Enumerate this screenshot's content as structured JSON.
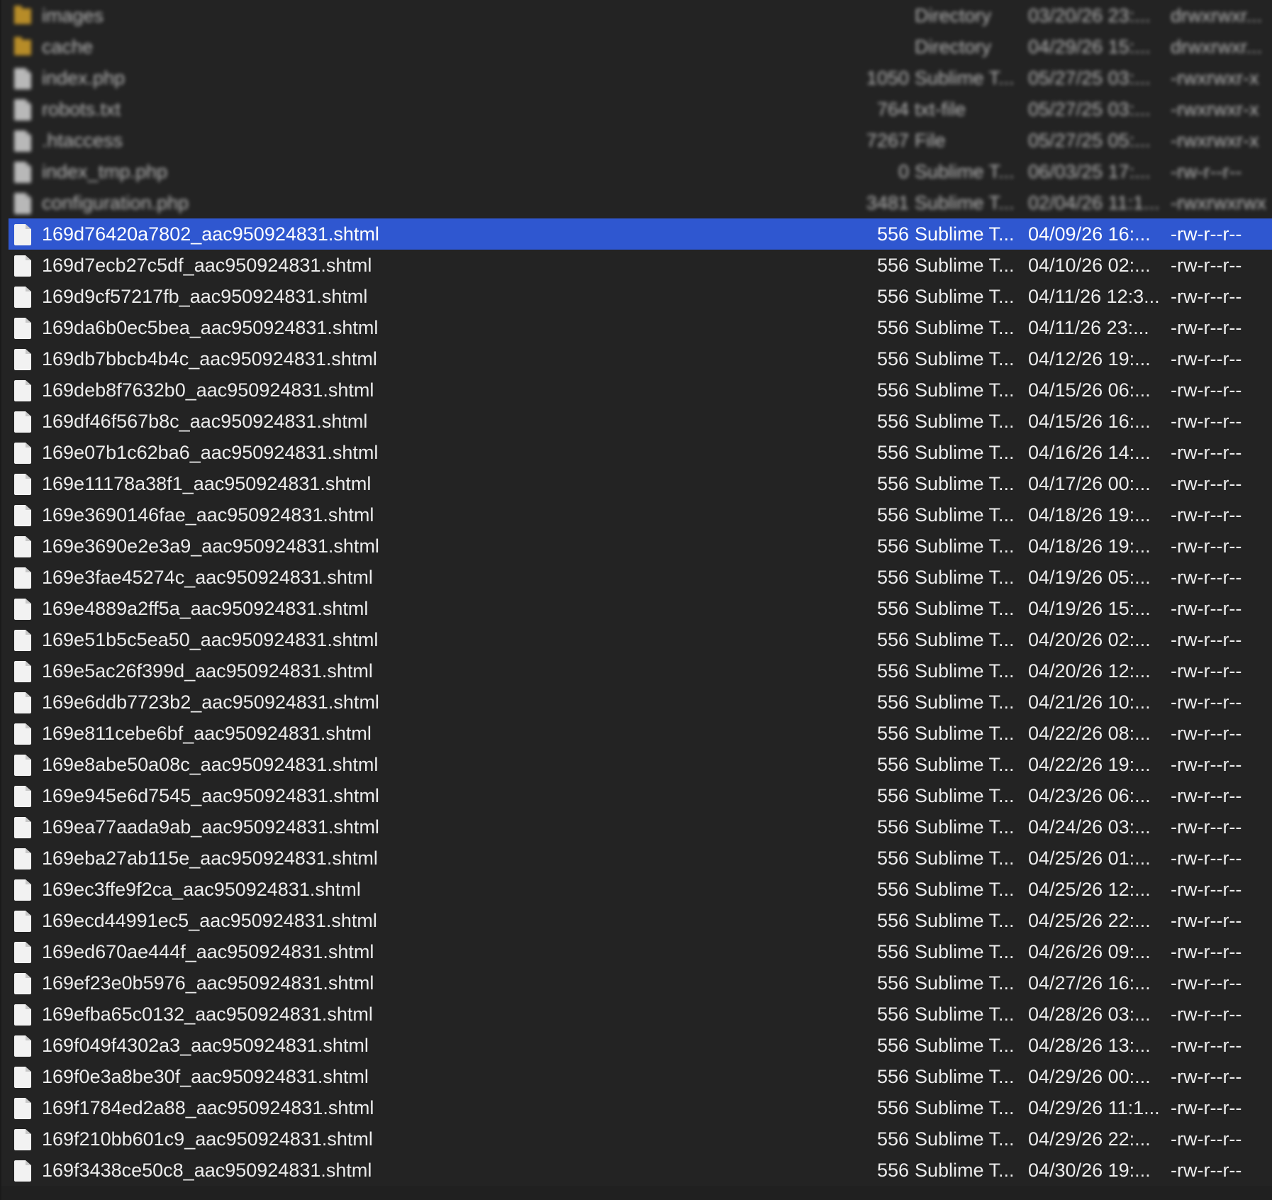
{
  "file_list": {
    "rows": [
      {
        "name": "images",
        "size": "",
        "kind": "Directory",
        "modified": "03/20/26 23:...",
        "perms": "drwxrwxr...",
        "icon": "folder-icon",
        "blurred": true,
        "selected": false
      },
      {
        "name": "cache",
        "size": "",
        "kind": "Directory",
        "modified": "04/29/26 15:...",
        "perms": "drwxrwxr...",
        "icon": "folder-icon",
        "blurred": true,
        "selected": false
      },
      {
        "name": "index.php",
        "size": "1050",
        "kind": "Sublime T...",
        "modified": "05/27/25 03:...",
        "perms": "-rwxrwxr-x",
        "icon": "file-icon",
        "blurred": true,
        "selected": false
      },
      {
        "name": "robots.txt",
        "size": "764",
        "kind": "txt-file",
        "modified": "05/27/25 03:...",
        "perms": "-rwxrwxr-x",
        "icon": "file-icon",
        "blurred": true,
        "selected": false
      },
      {
        "name": ".htaccess",
        "size": "7267",
        "kind": "File",
        "modified": "05/27/25 05:...",
        "perms": "-rwxrwxr-x",
        "icon": "file-icon",
        "blurred": true,
        "selected": false
      },
      {
        "name": "index_tmp.php",
        "size": "0",
        "kind": "Sublime T...",
        "modified": "06/03/25 17:...",
        "perms": "-rw-r--r--",
        "icon": "file-icon",
        "blurred": true,
        "selected": false
      },
      {
        "name": "configuration.php",
        "size": "3481",
        "kind": "Sublime T...",
        "modified": "02/04/26 11:1...",
        "perms": "-rwxrwxrwx",
        "icon": "file-icon",
        "blurred": true,
        "selected": false
      },
      {
        "name": "169d76420a7802_aac950924831.shtml",
        "size": "556",
        "kind": "Sublime T...",
        "modified": "04/09/26 16:...",
        "perms": "-rw-r--r--",
        "icon": "file-icon",
        "blurred": false,
        "selected": true
      },
      {
        "name": "169d7ecb27c5df_aac950924831.shtml",
        "size": "556",
        "kind": "Sublime T...",
        "modified": "04/10/26 02:...",
        "perms": "-rw-r--r--",
        "icon": "file-icon",
        "blurred": false,
        "selected": false
      },
      {
        "name": "169d9cf57217fb_aac950924831.shtml",
        "size": "556",
        "kind": "Sublime T...",
        "modified": "04/11/26 12:3...",
        "perms": "-rw-r--r--",
        "icon": "file-icon",
        "blurred": false,
        "selected": false
      },
      {
        "name": "169da6b0ec5bea_aac950924831.shtml",
        "size": "556",
        "kind": "Sublime T...",
        "modified": "04/11/26 23:...",
        "perms": "-rw-r--r--",
        "icon": "file-icon",
        "blurred": false,
        "selected": false
      },
      {
        "name": "169db7bbcb4b4c_aac950924831.shtml",
        "size": "556",
        "kind": "Sublime T...",
        "modified": "04/12/26 19:...",
        "perms": "-rw-r--r--",
        "icon": "file-icon",
        "blurred": false,
        "selected": false
      },
      {
        "name": "169deb8f7632b0_aac950924831.shtml",
        "size": "556",
        "kind": "Sublime T...",
        "modified": "04/15/26 06:...",
        "perms": "-rw-r--r--",
        "icon": "file-icon",
        "blurred": false,
        "selected": false
      },
      {
        "name": "169df46f567b8c_aac950924831.shtml",
        "size": "556",
        "kind": "Sublime T...",
        "modified": "04/15/26 16:...",
        "perms": "-rw-r--r--",
        "icon": "file-icon",
        "blurred": false,
        "selected": false
      },
      {
        "name": "169e07b1c62ba6_aac950924831.shtml",
        "size": "556",
        "kind": "Sublime T...",
        "modified": "04/16/26 14:...",
        "perms": "-rw-r--r--",
        "icon": "file-icon",
        "blurred": false,
        "selected": false
      },
      {
        "name": "169e11178a38f1_aac950924831.shtml",
        "size": "556",
        "kind": "Sublime T...",
        "modified": "04/17/26 00:...",
        "perms": "-rw-r--r--",
        "icon": "file-icon",
        "blurred": false,
        "selected": false
      },
      {
        "name": "169e3690146fae_aac950924831.shtml",
        "size": "556",
        "kind": "Sublime T...",
        "modified": "04/18/26 19:...",
        "perms": "-rw-r--r--",
        "icon": "file-icon",
        "blurred": false,
        "selected": false
      },
      {
        "name": "169e3690e2e3a9_aac950924831.shtml",
        "size": "556",
        "kind": "Sublime T...",
        "modified": "04/18/26 19:...",
        "perms": "-rw-r--r--",
        "icon": "file-icon",
        "blurred": false,
        "selected": false
      },
      {
        "name": "169e3fae45274c_aac950924831.shtml",
        "size": "556",
        "kind": "Sublime T...",
        "modified": "04/19/26 05:...",
        "perms": "-rw-r--r--",
        "icon": "file-icon",
        "blurred": false,
        "selected": false
      },
      {
        "name": "169e4889a2ff5a_aac950924831.shtml",
        "size": "556",
        "kind": "Sublime T...",
        "modified": "04/19/26 15:...",
        "perms": "-rw-r--r--",
        "icon": "file-icon",
        "blurred": false,
        "selected": false
      },
      {
        "name": "169e51b5c5ea50_aac950924831.shtml",
        "size": "556",
        "kind": "Sublime T...",
        "modified": "04/20/26 02:...",
        "perms": "-rw-r--r--",
        "icon": "file-icon",
        "blurred": false,
        "selected": false
      },
      {
        "name": "169e5ac26f399d_aac950924831.shtml",
        "size": "556",
        "kind": "Sublime T...",
        "modified": "04/20/26 12:...",
        "perms": "-rw-r--r--",
        "icon": "file-icon",
        "blurred": false,
        "selected": false
      },
      {
        "name": "169e6ddb7723b2_aac950924831.shtml",
        "size": "556",
        "kind": "Sublime T...",
        "modified": "04/21/26 10:...",
        "perms": "-rw-r--r--",
        "icon": "file-icon",
        "blurred": false,
        "selected": false
      },
      {
        "name": "169e811cebe6bf_aac950924831.shtml",
        "size": "556",
        "kind": "Sublime T...",
        "modified": "04/22/26 08:...",
        "perms": "-rw-r--r--",
        "icon": "file-icon",
        "blurred": false,
        "selected": false
      },
      {
        "name": "169e8abe50a08c_aac950924831.shtml",
        "size": "556",
        "kind": "Sublime T...",
        "modified": "04/22/26 19:...",
        "perms": "-rw-r--r--",
        "icon": "file-icon",
        "blurred": false,
        "selected": false
      },
      {
        "name": "169e945e6d7545_aac950924831.shtml",
        "size": "556",
        "kind": "Sublime T...",
        "modified": "04/23/26 06:...",
        "perms": "-rw-r--r--",
        "icon": "file-icon",
        "blurred": false,
        "selected": false
      },
      {
        "name": "169ea77aada9ab_aac950924831.shtml",
        "size": "556",
        "kind": "Sublime T...",
        "modified": "04/24/26 03:...",
        "perms": "-rw-r--r--",
        "icon": "file-icon",
        "blurred": false,
        "selected": false
      },
      {
        "name": "169eba27ab115e_aac950924831.shtml",
        "size": "556",
        "kind": "Sublime T...",
        "modified": "04/25/26 01:...",
        "perms": "-rw-r--r--",
        "icon": "file-icon",
        "blurred": false,
        "selected": false
      },
      {
        "name": "169ec3ffe9f2ca_aac950924831.shtml",
        "size": "556",
        "kind": "Sublime T...",
        "modified": "04/25/26 12:...",
        "perms": "-rw-r--r--",
        "icon": "file-icon",
        "blurred": false,
        "selected": false
      },
      {
        "name": "169ecd44991ec5_aac950924831.shtml",
        "size": "556",
        "kind": "Sublime T...",
        "modified": "04/25/26 22:...",
        "perms": "-rw-r--r--",
        "icon": "file-icon",
        "blurred": false,
        "selected": false
      },
      {
        "name": "169ed670ae444f_aac950924831.shtml",
        "size": "556",
        "kind": "Sublime T...",
        "modified": "04/26/26 09:...",
        "perms": "-rw-r--r--",
        "icon": "file-icon",
        "blurred": false,
        "selected": false
      },
      {
        "name": "169ef23e0b5976_aac950924831.shtml",
        "size": "556",
        "kind": "Sublime T...",
        "modified": "04/27/26 16:...",
        "perms": "-rw-r--r--",
        "icon": "file-icon",
        "blurred": false,
        "selected": false
      },
      {
        "name": "169efba65c0132_aac950924831.shtml",
        "size": "556",
        "kind": "Sublime T...",
        "modified": "04/28/26 03:...",
        "perms": "-rw-r--r--",
        "icon": "file-icon",
        "blurred": false,
        "selected": false
      },
      {
        "name": "169f049f4302a3_aac950924831.shtml",
        "size": "556",
        "kind": "Sublime T...",
        "modified": "04/28/26 13:...",
        "perms": "-rw-r--r--",
        "icon": "file-icon",
        "blurred": false,
        "selected": false
      },
      {
        "name": "169f0e3a8be30f_aac950924831.shtml",
        "size": "556",
        "kind": "Sublime T...",
        "modified": "04/29/26 00:...",
        "perms": "-rw-r--r--",
        "icon": "file-icon",
        "blurred": false,
        "selected": false
      },
      {
        "name": "169f1784ed2a88_aac950924831.shtml",
        "size": "556",
        "kind": "Sublime T...",
        "modified": "04/29/26 11:1...",
        "perms": "-rw-r--r--",
        "icon": "file-icon",
        "blurred": false,
        "selected": false
      },
      {
        "name": "169f210bb601c9_aac950924831.shtml",
        "size": "556",
        "kind": "Sublime T...",
        "modified": "04/29/26 22:...",
        "perms": "-rw-r--r--",
        "icon": "file-icon",
        "blurred": false,
        "selected": false
      },
      {
        "name": "169f3438ce50c8_aac950924831.shtml",
        "size": "556",
        "kind": "Sublime T...",
        "modified": "04/30/26 19:...",
        "perms": "-rw-r--r--",
        "icon": "file-icon",
        "blurred": false,
        "selected": false
      }
    ]
  },
  "colors": {
    "background": "#232323",
    "selection": "#2f57d0",
    "text": "#ececec",
    "folder": "#f0b52b"
  }
}
